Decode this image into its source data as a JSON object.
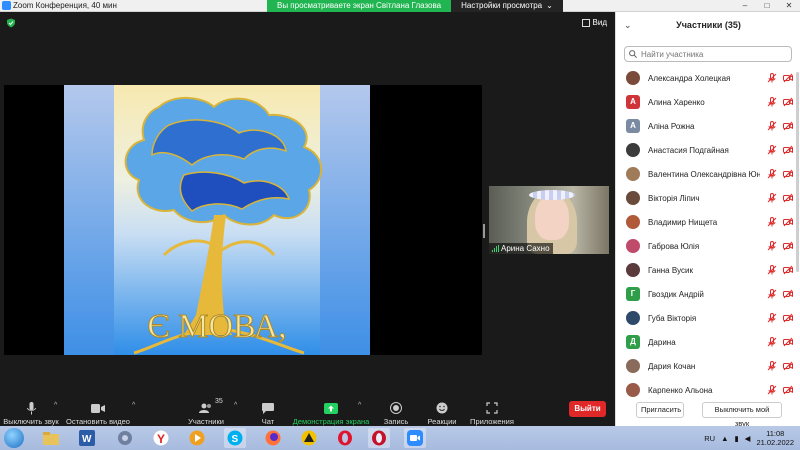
{
  "window": {
    "title": "Zoom Конференция, 40 мин"
  },
  "share_banner": {
    "text": "Вы просматриваете экран Світлана Глазова",
    "view_options": "Настройки просмотра"
  },
  "view_label": "Вид",
  "shared_content": {
    "caption": "Є МОВА,"
  },
  "thumbnail": {
    "name": "Арина Сахно"
  },
  "toolbar": {
    "mute": "Выключить звук",
    "stop_video": "Остановить видео",
    "participants": "Участники",
    "participants_count": "35",
    "chat": "Чат",
    "share_screen": "Демонстрация экрана",
    "record": "Запись",
    "reactions": "Реакции",
    "apps": "Приложения",
    "leave": "Выйти"
  },
  "panel": {
    "title": "Участники (35)",
    "search_placeholder": "Найти участника",
    "participants": [
      {
        "name": "Александра Холецкая",
        "initial": "",
        "color": "#7a4b3a"
      },
      {
        "name": "Алина Харенко",
        "initial": "А",
        "color": "#d13438"
      },
      {
        "name": "Аліна Рожна",
        "initial": "А",
        "color": "#7a8aa0"
      },
      {
        "name": "Анастасия Подгайная",
        "initial": "",
        "color": "#3b3b3b"
      },
      {
        "name": "Валентина Олександрівна Юн...",
        "initial": "",
        "color": "#a07b5a"
      },
      {
        "name": "Вікторія Ліпич",
        "initial": "",
        "color": "#6a4a3a"
      },
      {
        "name": "Владимир Нищета",
        "initial": "",
        "color": "#b05a3a"
      },
      {
        "name": "Габрова Юлія",
        "initial": "",
        "color": "#c04a6a"
      },
      {
        "name": "Ганна Вусик",
        "initial": "",
        "color": "#5a3a3a"
      },
      {
        "name": "Гвоздик Андрій",
        "initial": "Г",
        "color": "#2e9e49"
      },
      {
        "name": "Губа Вікторія",
        "initial": "",
        "color": "#2e4a6a"
      },
      {
        "name": "Дарина",
        "initial": "Д",
        "color": "#2e9e49"
      },
      {
        "name": "Дария Кочан",
        "initial": "",
        "color": "#8a6a5a"
      },
      {
        "name": "Карпенко Альона",
        "initial": "",
        "color": "#9a5a4a"
      }
    ],
    "invite": "Пригласить",
    "mute_me": "Выключить мой звук"
  },
  "taskbar": {
    "lang": "RU",
    "time": "11:08",
    "date": "21.02.2022"
  }
}
